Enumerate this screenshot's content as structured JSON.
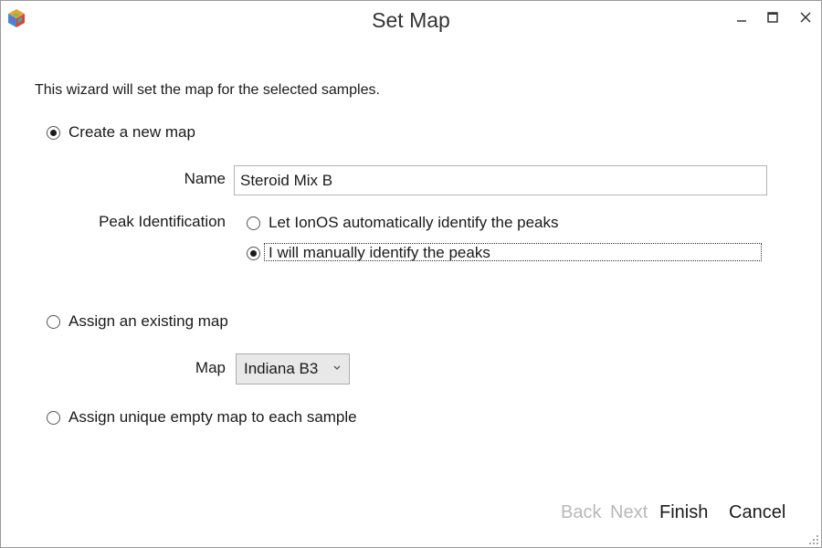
{
  "window": {
    "title": "Set Map",
    "app_icon": "ionos-cube-icon",
    "controls": {
      "minimize_icon": "minimize-icon",
      "maximize_icon": "maximize-icon",
      "close_icon": "close-icon"
    }
  },
  "intro_text": "This wizard will set the map for the selected samples.",
  "options": {
    "create_new": {
      "label": "Create a new map",
      "selected": true,
      "name_label": "Name",
      "name_value": "Steroid Mix B",
      "peak_label": "Peak Identification",
      "peak_options": [
        {
          "label": "Let IonOS automatically identify the peaks",
          "selected": false
        },
        {
          "label": "I will manually identify the peaks",
          "selected": true
        }
      ]
    },
    "assign_existing": {
      "label": "Assign an existing map",
      "selected": false,
      "map_label": "Map",
      "map_value": "Indiana B3"
    },
    "assign_unique": {
      "label": "Assign unique empty map to each sample",
      "selected": false
    }
  },
  "footer": {
    "back_label": "Back",
    "next_label": "Next",
    "finish_label": "Finish",
    "cancel_label": "Cancel"
  },
  "colors": {
    "text": "#1a1a1a",
    "disabled_text": "#b8b8b8",
    "border": "#9a9a9a",
    "select_bg": "#e8e8e8"
  }
}
